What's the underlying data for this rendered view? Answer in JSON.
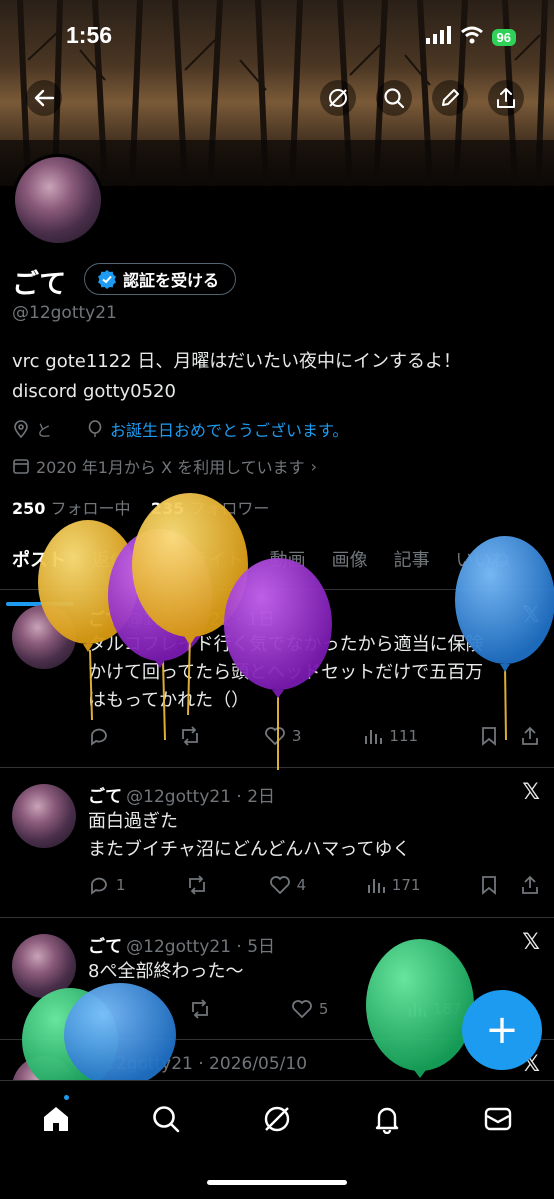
{
  "status": {
    "time": "1:56",
    "battery": "96"
  },
  "profile": {
    "name": "ごて",
    "verify_label": "認証を受ける",
    "handle": "@12gotty21",
    "bio_line1": "vrc gote1122 日、月曜はだいたい夜中にインするよ！",
    "bio_line2": "discord gotty0520",
    "location": "と",
    "birthday_link": "お誕生日おめでとうございます。",
    "joined": "2020 年1月から X を利用しています",
    "following_count": "250",
    "following_label": "フォロー中",
    "followers_count": "235",
    "followers_label": "フォロワー"
  },
  "tabs": [
    "ポスト",
    "返信",
    "ハイライト",
    "動画",
    "画像",
    "記事",
    "いいね"
  ],
  "posts": [
    {
      "name": "ごて",
      "meta": "@12gotty21 · 1日",
      "line1": "タルコフレイド行く気でなかったから適当に保険",
      "line2": "かけて回ってたら頭とヘッドセットだけで五百万",
      "line3": "はもってかれた（）",
      "replies": "",
      "reposts": "",
      "likes": "3",
      "views": "111"
    },
    {
      "name": "ごて",
      "meta": "@12gotty21 · 2日",
      "line1": "面白過ぎた",
      "line2": "またブイチャ沼にどんどんハマってゆく",
      "line3": "",
      "replies": "1",
      "reposts": "",
      "likes": "4",
      "views": "171"
    },
    {
      "name": "ごて",
      "meta": "@12gotty21 · 5日",
      "line1": "8ぺ全部終わった〜",
      "line2": "",
      "line3": "",
      "replies": "",
      "reposts": "",
      "likes": "5",
      "views": "187"
    },
    {
      "name": "",
      "meta": "@12gotty21 · 2026/05/10",
      "line1": "",
      "line2": "",
      "line3": "",
      "replies": "",
      "reposts": "",
      "likes": "",
      "views": ""
    }
  ],
  "colors": {
    "accent": "#1d9bf0",
    "balloon_yellow": "#f2c12e",
    "balloon_purple": "#a234d6",
    "balloon_blue": "#3a94e6",
    "balloon_green": "#2ecc71"
  }
}
